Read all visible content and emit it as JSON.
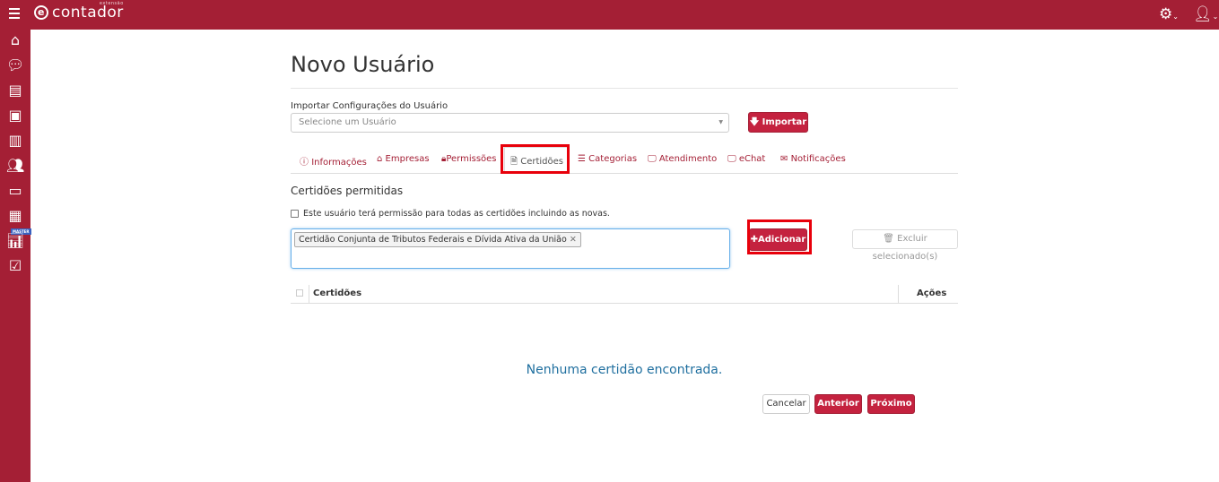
{
  "header": {
    "logo_text": "contador",
    "logo_sup": "extensão",
    "logo_letter": "e"
  },
  "page_title": "Novo Usuário",
  "import": {
    "label": "Importar Configurações do Usuário",
    "placeholder": "Selecione um Usuário",
    "button": "Importar"
  },
  "tabs": [
    {
      "label": "Informações",
      "icon": "info-icon"
    },
    {
      "label": "Empresas",
      "icon": "home-icon"
    },
    {
      "label": "Permissões",
      "icon": "lock-icon"
    },
    {
      "label": "Certidões",
      "icon": "file-icon"
    },
    {
      "label": "Categorias",
      "icon": "list-icon"
    },
    {
      "label": "Atendimento",
      "icon": "monitor-icon"
    },
    {
      "label": "eChat",
      "icon": "monitor-icon"
    },
    {
      "label": "Notificações",
      "icon": "envelope-icon"
    }
  ],
  "section": {
    "title": "Certidões permitidas",
    "checkbox_label": "Este usuário terá permissão para todas as certidões incluindo as novas.",
    "tag": "Certidão Conjunta de Tributos Federais e Dívida Ativa da União",
    "add_button": "Adicionar",
    "delete_button": "Excluir selecionado(s)"
  },
  "table": {
    "columns": [
      "Certidões",
      "Ações"
    ],
    "empty": "Nenhuma certidão encontrada."
  },
  "footer": {
    "cancel": "Cancelar",
    "previous": "Anterior",
    "next": "Próximo"
  },
  "sidebar": {
    "badge": "MASTER"
  }
}
